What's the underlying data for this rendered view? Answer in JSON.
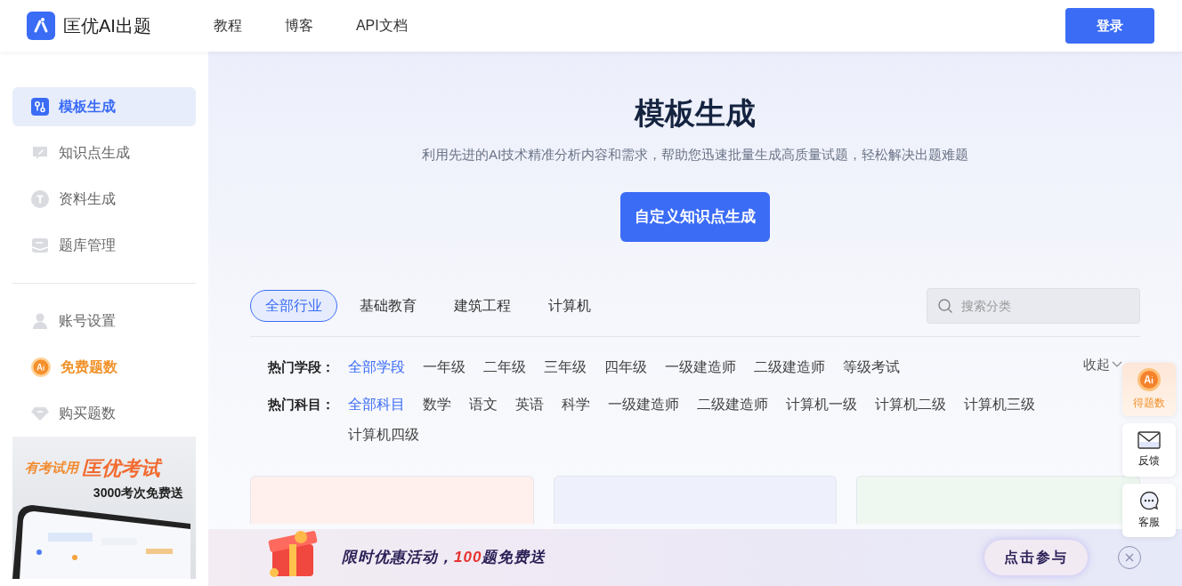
{
  "header": {
    "logo_text": "匡优AI出题",
    "nav": [
      "教程",
      "博客",
      "API文档"
    ],
    "login_button": "登录"
  },
  "sidebar": {
    "sections": [
      {
        "items": [
          {
            "label": "模板生成",
            "kind": "template",
            "selected": true,
            "highlighted": false
          },
          {
            "label": "知识点生成",
            "kind": "pencil",
            "selected": false,
            "highlighted": false
          },
          {
            "label": "资料生成",
            "kind": "text",
            "selected": false,
            "highlighted": false
          },
          {
            "label": "题库管理",
            "kind": "tray",
            "selected": false,
            "highlighted": false
          }
        ]
      },
      {
        "items": [
          {
            "label": "账号设置",
            "kind": "user",
            "selected": false,
            "highlighted": false
          },
          {
            "label": "免费题数",
            "kind": "ai",
            "selected": false,
            "highlighted": true
          },
          {
            "label": "购买题数",
            "kind": "gem",
            "selected": false,
            "highlighted": false
          }
        ]
      }
    ],
    "promo": {
      "tagline": "有考试用",
      "brand": "匡优考试",
      "offer": "3000考次免费送"
    }
  },
  "hero": {
    "title": "模板生成",
    "subtitle": "利用先进的AI技术精准分析内容和需求，帮助您迅速批量生成高质量试题，轻松解决出题难题",
    "button": "自定义知识点生成"
  },
  "industry_tabs": [
    {
      "label": "全部行业",
      "selected": true
    },
    {
      "label": "基础教育",
      "selected": false
    },
    {
      "label": "建筑工程",
      "selected": false
    },
    {
      "label": "计算机",
      "selected": false
    }
  ],
  "search": {
    "placeholder": "搜索分类"
  },
  "filters": [
    {
      "label": "热门学段：",
      "options": [
        {
          "label": "全部学段",
          "selected": true
        },
        {
          "label": "一年级",
          "selected": false
        },
        {
          "label": "二年级",
          "selected": false
        },
        {
          "label": "三年级",
          "selected": false
        },
        {
          "label": "四年级",
          "selected": false
        },
        {
          "label": "一级建造师",
          "selected": false
        },
        {
          "label": "二级建造师",
          "selected": false
        },
        {
          "label": "等级考试",
          "selected": false
        }
      ]
    },
    {
      "label": "热门科目：",
      "options": [
        {
          "label": "全部科目",
          "selected": true
        },
        {
          "label": "数学",
          "selected": false
        },
        {
          "label": "语文",
          "selected": false
        },
        {
          "label": "英语",
          "selected": false
        },
        {
          "label": "科学",
          "selected": false
        },
        {
          "label": "一级建造师",
          "selected": false
        },
        {
          "label": "二级建造师",
          "selected": false
        },
        {
          "label": "计算机一级",
          "selected": false
        },
        {
          "label": "计算机二级",
          "selected": false
        },
        {
          "label": "计算机三级",
          "selected": false
        },
        {
          "label": "计算机四级",
          "selected": false
        }
      ]
    }
  ],
  "collapse": "收起",
  "cards": [
    {
      "color": "#fff0ee"
    },
    {
      "color": "#eef0fc"
    },
    {
      "color": "#eef8f1"
    }
  ],
  "float_widgets": [
    {
      "label": "得题数",
      "kind": "ai"
    },
    {
      "label": "反馈",
      "kind": "mail"
    },
    {
      "label": "客服",
      "kind": "chat"
    }
  ],
  "bottom_banner": {
    "text_before": "限时优惠活动，",
    "highlight": "100",
    "text_after": "题免费送",
    "button": "点击参与"
  }
}
